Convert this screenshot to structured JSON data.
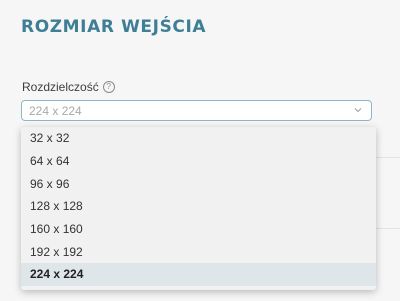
{
  "section": {
    "title": "ROZMIAR WEJŚCIA"
  },
  "field": {
    "label": "Rozdzielczość",
    "help_icon": "question-circle-icon",
    "select_value": "224 x 224"
  },
  "dropdown": {
    "options": [
      {
        "label": "32 x 32"
      },
      {
        "label": "64 x 64"
      },
      {
        "label": "96 x 96"
      },
      {
        "label": "128 x 128"
      },
      {
        "label": "160 x 160"
      },
      {
        "label": "192 x 192"
      },
      {
        "label": "224 x 224"
      }
    ],
    "selected_label": "224 x 224"
  },
  "colors": {
    "title": "#3f7f95",
    "select_border": "#8fb6c6",
    "selected_bg": "#dfe6ea",
    "page_bg": "#f6f6f6"
  }
}
